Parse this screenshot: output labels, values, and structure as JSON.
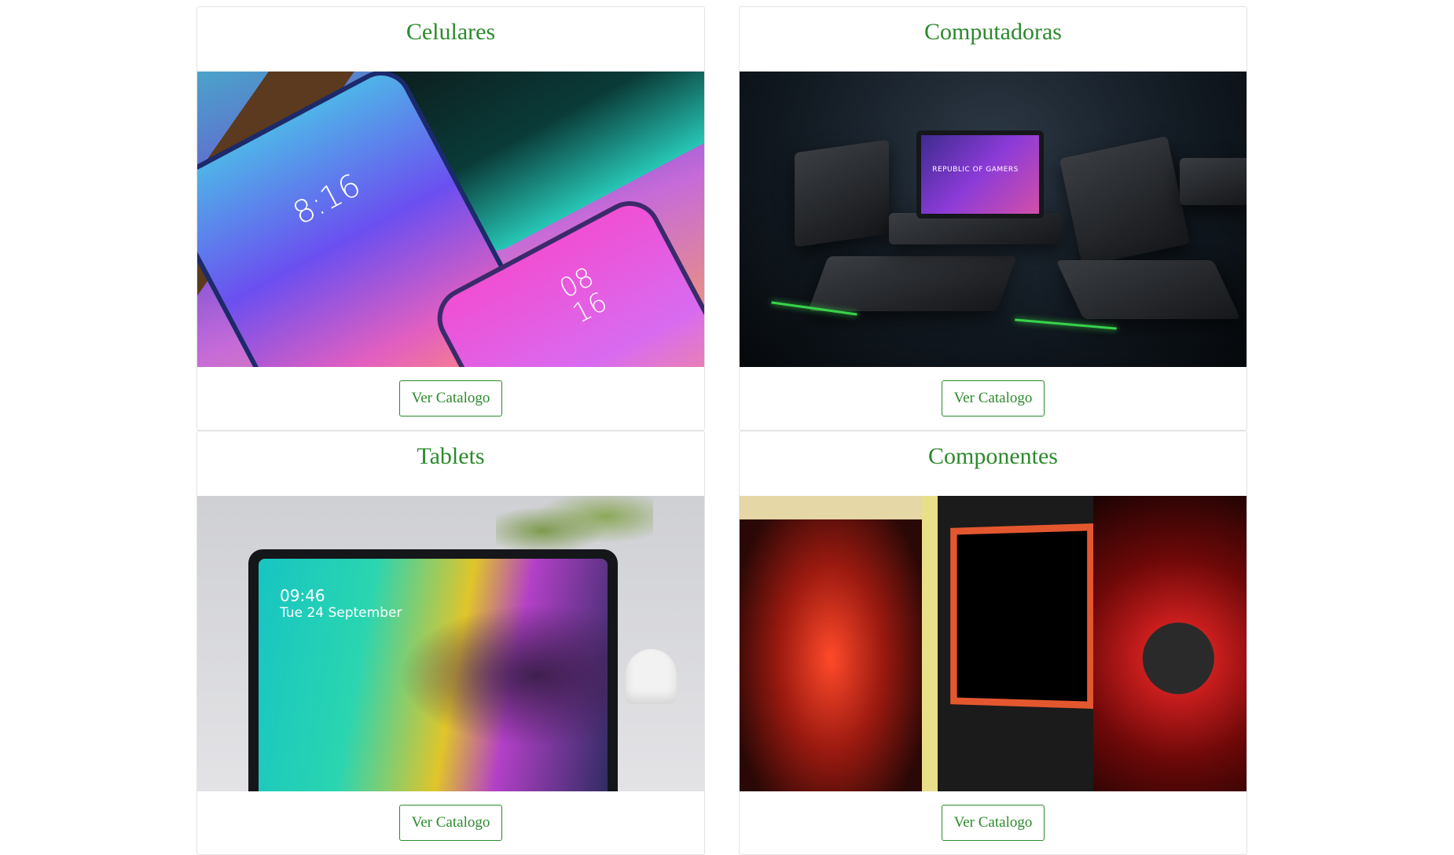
{
  "cards": [
    {
      "title": "Celulares",
      "button_label": "Ver Catalogo",
      "image_alt": "phones"
    },
    {
      "title": "Computadoras",
      "button_label": "Ver Catalogo",
      "image_alt": "laptops"
    },
    {
      "title": "Tablets",
      "button_label": "Ver Catalogo",
      "image_alt": "tablet"
    },
    {
      "title": "Componentes",
      "button_label": "Ver Catalogo",
      "image_alt": "components"
    }
  ],
  "image_text": {
    "phone_clock_1": "8:16",
    "phone_clock_2": "08\n16",
    "laptop_brand": "REPUBLIC OF GAMERS",
    "tablet_time": "09:46",
    "tablet_date": "Tue 24 September"
  },
  "colors": {
    "accent_green": "#2b8a2b",
    "card_border": "#e3e3e3"
  }
}
